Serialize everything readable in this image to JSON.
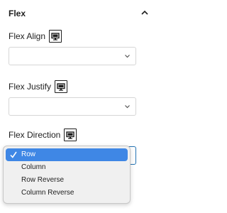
{
  "panel": {
    "title": "Flex",
    "toggle_icon": "chevron-up-icon"
  },
  "fields": {
    "align": {
      "label": "Flex Align",
      "value": "",
      "device_icon": "desktop-icon"
    },
    "justify": {
      "label": "Flex Justify",
      "value": "",
      "device_icon": "desktop-icon"
    },
    "direction": {
      "label": "Flex Direction",
      "value": "Row",
      "device_icon": "desktop-icon"
    }
  },
  "dropdown": {
    "options": [
      {
        "label": "Row",
        "selected": true
      },
      {
        "label": "Column",
        "selected": false
      },
      {
        "label": "Row Reverse",
        "selected": false
      },
      {
        "label": "Column Reverse",
        "selected": false
      }
    ],
    "selected_color": "#3f87e5"
  }
}
